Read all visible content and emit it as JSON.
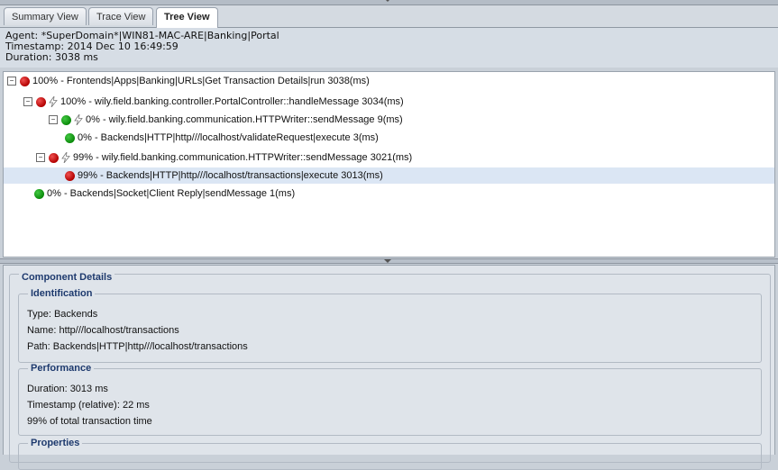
{
  "tabs": [
    {
      "label": "Summary View"
    },
    {
      "label": "Trace View"
    },
    {
      "label": "Tree View"
    }
  ],
  "info": {
    "agent": "Agent: *SuperDomain*|WIN81-MAC-ARE|Banking|Portal",
    "timestamp": "Timestamp: 2014 Dec 10 16:49:59",
    "duration": "Duration: 3038 ms"
  },
  "tree": {
    "rows": [
      {
        "text": "100% - Frontends|Apps|Banking|URLs|Get Transaction Details|run 3038(ms)",
        "status": "red",
        "expanded": true
      },
      {
        "text": "100% - wily.field.banking.controller.PortalController::handleMessage 3034(ms)",
        "status": "red",
        "expanded": true
      },
      {
        "text": "0% - wily.field.banking.communication.HTTPWriter::sendMessage 9(ms)",
        "status": "green",
        "expanded": true
      },
      {
        "text": "0% - Backends|HTTP|http///localhost/validateRequest|execute 3(ms)",
        "status": "green"
      },
      {
        "text": "99% - wily.field.banking.communication.HTTPWriter::sendMessage 3021(ms)",
        "status": "red",
        "expanded": true
      },
      {
        "text": "99% - Backends|HTTP|http///localhost/transactions|execute 3013(ms)",
        "status": "red",
        "selected": true
      },
      {
        "text": "0% - Backends|Socket|Client Reply|sendMessage 1(ms)",
        "status": "green"
      }
    ]
  },
  "details": {
    "title": "Component Details",
    "identification": {
      "title": "Identification",
      "type": "Type: Backends",
      "name": "Name: http///localhost/transactions",
      "path": "Path: Backends|HTTP|http///localhost/transactions"
    },
    "performance": {
      "title": "Performance",
      "duration": "Duration: 3013 ms",
      "timestamp": "Timestamp (relative): 22 ms",
      "share": "99% of total transaction time"
    },
    "properties": {
      "title": "Properties"
    }
  },
  "colors": {
    "status_red": "#c00000",
    "status_green": "#0a8a0a",
    "section_title": "#1e3a6e",
    "selection": "#dbe6f4"
  }
}
